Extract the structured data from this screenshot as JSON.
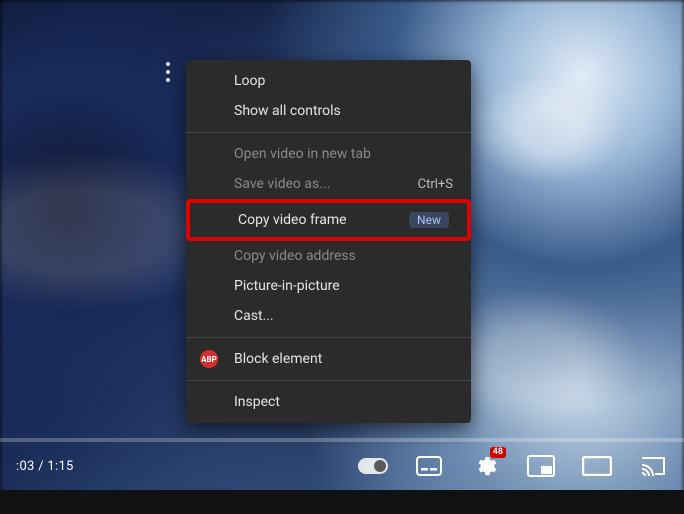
{
  "player": {
    "time_current": ":03",
    "time_sep": " / ",
    "time_total": "1:15",
    "settings_badge": "48"
  },
  "context_menu": {
    "items": [
      {
        "label": "Loop",
        "enabled": true
      },
      {
        "label": "Show all controls",
        "enabled": true
      },
      {
        "type": "sep"
      },
      {
        "label": "Open video in new tab",
        "enabled": false
      },
      {
        "label": "Save video as...",
        "enabled": false,
        "shortcut": "Ctrl+S"
      },
      {
        "label": "Copy video frame",
        "enabled": true,
        "badge": "New",
        "highlight": true
      },
      {
        "label": "Copy video address",
        "enabled": false
      },
      {
        "label": "Picture-in-picture",
        "enabled": true
      },
      {
        "label": "Cast...",
        "enabled": true
      },
      {
        "type": "sep"
      },
      {
        "label": "Block element",
        "enabled": true,
        "icon": "abp"
      },
      {
        "type": "sep"
      },
      {
        "label": "Inspect",
        "enabled": true
      }
    ]
  }
}
